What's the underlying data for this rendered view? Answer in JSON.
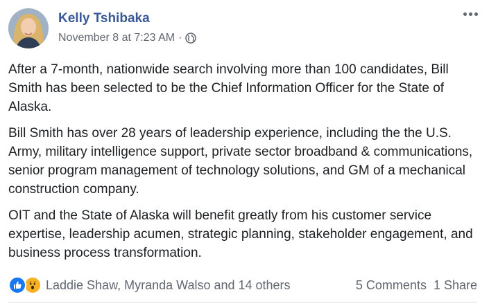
{
  "post": {
    "author": "Kelly Tshibaka",
    "timestamp": "November 8 at 7:23 AM",
    "separator": "·",
    "audience_icon": "globe-icon",
    "menu_icon": "more-options-icon",
    "paragraphs": [
      "After a 7-month, nationwide search involving more than 100 candidates, Bill Smith has been selected to be the Chief Information Officer for the State of Alaska.",
      "Bill Smith has over 28 years of leadership experience, including the the U.S. Army, military intelligence support, private sector broadband & communications, senior program management of technology solutions, and GM of a mechanical construction company.",
      "OIT and the State of Alaska will benefit greatly from his customer service expertise, leadership acumen, strategic planning, stakeholder engagement, and business process transformation."
    ]
  },
  "engagement": {
    "reaction_icons": [
      "like-icon",
      "wow-icon"
    ],
    "reacted_by": "Laddie Shaw, Myranda Walso and 14 others",
    "comments": "5 Comments",
    "shares": "1 Share"
  },
  "colors": {
    "author_link": "#385898",
    "secondary_text": "#606770",
    "like_blue": "#1877f2",
    "wow_yellow": "#f7b125"
  }
}
